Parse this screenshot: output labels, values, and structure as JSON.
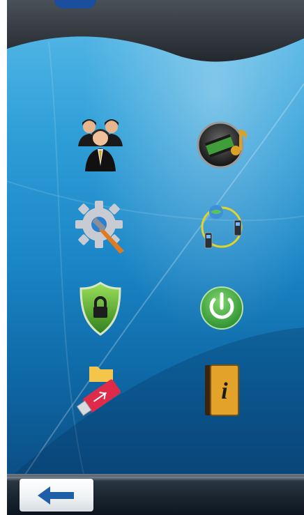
{
  "header": {
    "logo_mark": "brand-glyph"
  },
  "menu": {
    "items": [
      {
        "name": "users-icon",
        "label": ""
      },
      {
        "name": "media-icon",
        "label": ""
      },
      {
        "name": "settings-icon",
        "label": ""
      },
      {
        "name": "network-icon",
        "label": ""
      },
      {
        "name": "security-lock-icon",
        "label": ""
      },
      {
        "name": "power-icon",
        "label": ""
      },
      {
        "name": "usb-drive-icon",
        "label": ""
      },
      {
        "name": "info-book-icon",
        "label": ""
      }
    ]
  },
  "footer": {
    "back_icon": "arrow-left-icon"
  },
  "colors": {
    "header": "#2d3238",
    "screen_top": "#5bbbe8",
    "screen_bottom": "#0b4f86",
    "footer": "#1b2631",
    "power_green": "#3cae3f",
    "back_arrow": "#1f5fa8"
  }
}
